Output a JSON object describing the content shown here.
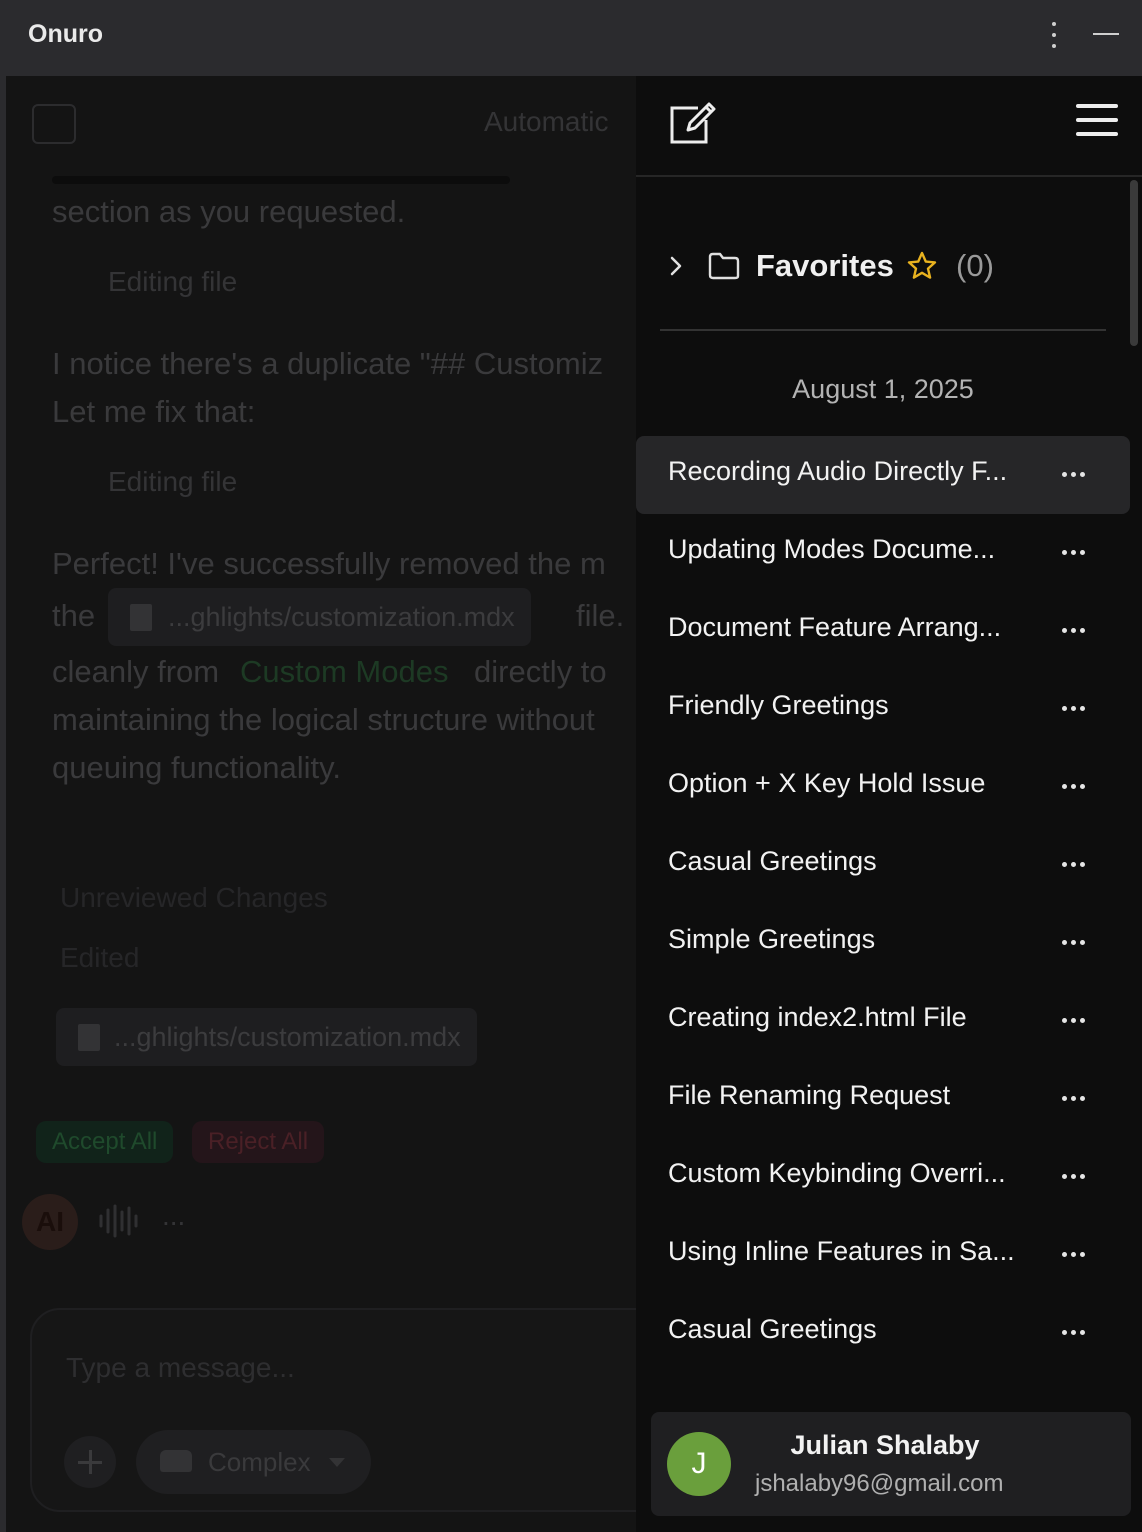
{
  "app": {
    "title": "Onuro"
  },
  "chat": {
    "header_label": "Automatic",
    "lines": [
      "section as you requested.",
      "I notice there's a duplicate \"## Customiz",
      "Let me fix that:",
      "Perfect! I've successfully removed the m",
      "maintaining the logical structure without",
      "queuing functionality."
    ],
    "editing_1": "Editing file",
    "editing_2": "Editing file",
    "the_word": "the",
    "file_chip": "...ghlights/customization.mdx",
    "file_word": "file.",
    "line_clean_1": "cleanly from",
    "custom_modes": "Custom Modes",
    "line_clean_2": "directly to",
    "unreviewed": "Unreviewed Changes",
    "edited": "Edited",
    "edited_file": "...ghlights/customization.mdx",
    "accept_all": "Accept All",
    "reject_all": "Reject All",
    "ai_badge": "AI",
    "more": "...",
    "input_placeholder": "Type a message...",
    "mode_label": "Complex"
  },
  "sidebar": {
    "favorites_label": "Favorites",
    "favorites_count": "(0)",
    "date": "August 1, 2025",
    "conversations": [
      {
        "title": "Recording Audio Directly F..."
      },
      {
        "title": "Updating Modes Docume..."
      },
      {
        "title": "Document Feature Arrang..."
      },
      {
        "title": "Friendly Greetings"
      },
      {
        "title": "Option + X Key Hold Issue"
      },
      {
        "title": "Casual Greetings"
      },
      {
        "title": "Simple Greetings"
      },
      {
        "title": "Creating index2.html File"
      },
      {
        "title": "File Renaming Request"
      },
      {
        "title": "Custom Keybinding Overri..."
      },
      {
        "title": "Using Inline Features in Sa..."
      },
      {
        "title": "Casual Greetings"
      }
    ],
    "user": {
      "initial": "J",
      "name": "Julian Shalaby",
      "email": "jshalaby96@gmail.com"
    }
  },
  "colors": {
    "accent_star": "#e8b21f",
    "avatar_green": "#6a9f3c",
    "sidebar_bg": "#0d0d0d",
    "active_row": "#262628"
  }
}
